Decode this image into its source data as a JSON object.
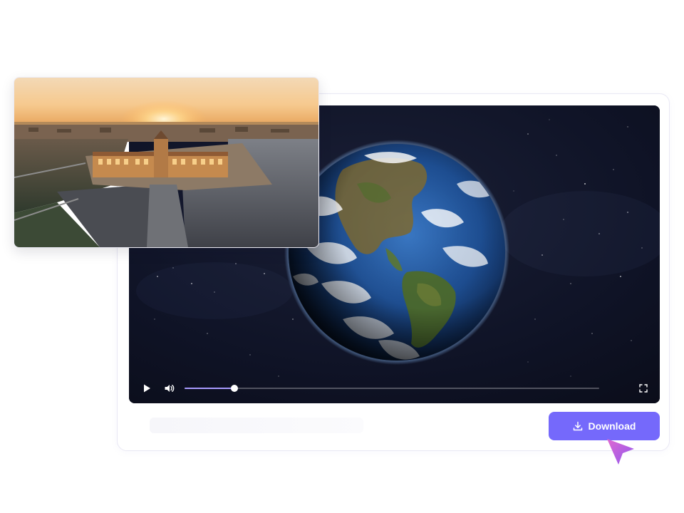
{
  "player": {
    "progress_fraction": 0.12,
    "controls": {
      "play_icon": "play-icon",
      "volume_icon": "volume-icon",
      "fullscreen_icon": "fullscreen-icon"
    }
  },
  "download": {
    "label": "Download",
    "icon": "download-icon"
  },
  "colors": {
    "accent": "#7569fb",
    "progress": "#a89bff",
    "cursor": "#b45cf0"
  }
}
